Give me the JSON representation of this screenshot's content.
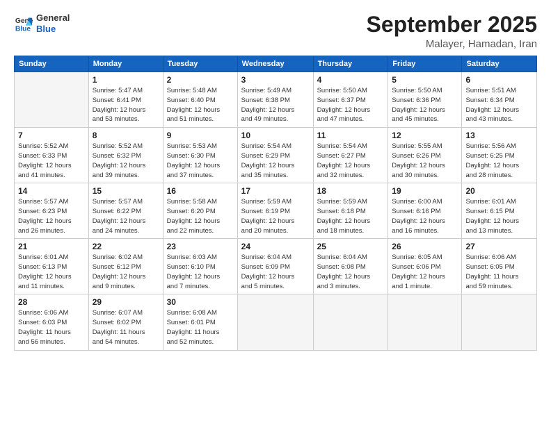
{
  "logo": {
    "line1": "General",
    "line2": "Blue"
  },
  "title": "September 2025",
  "subtitle": "Malayer, Hamadan, Iran",
  "days_header": [
    "Sunday",
    "Monday",
    "Tuesday",
    "Wednesday",
    "Thursday",
    "Friday",
    "Saturday"
  ],
  "weeks": [
    [
      {
        "num": "",
        "info": ""
      },
      {
        "num": "1",
        "info": "Sunrise: 5:47 AM\nSunset: 6:41 PM\nDaylight: 12 hours\nand 53 minutes."
      },
      {
        "num": "2",
        "info": "Sunrise: 5:48 AM\nSunset: 6:40 PM\nDaylight: 12 hours\nand 51 minutes."
      },
      {
        "num": "3",
        "info": "Sunrise: 5:49 AM\nSunset: 6:38 PM\nDaylight: 12 hours\nand 49 minutes."
      },
      {
        "num": "4",
        "info": "Sunrise: 5:50 AM\nSunset: 6:37 PM\nDaylight: 12 hours\nand 47 minutes."
      },
      {
        "num": "5",
        "info": "Sunrise: 5:50 AM\nSunset: 6:36 PM\nDaylight: 12 hours\nand 45 minutes."
      },
      {
        "num": "6",
        "info": "Sunrise: 5:51 AM\nSunset: 6:34 PM\nDaylight: 12 hours\nand 43 minutes."
      }
    ],
    [
      {
        "num": "7",
        "info": "Sunrise: 5:52 AM\nSunset: 6:33 PM\nDaylight: 12 hours\nand 41 minutes."
      },
      {
        "num": "8",
        "info": "Sunrise: 5:52 AM\nSunset: 6:32 PM\nDaylight: 12 hours\nand 39 minutes."
      },
      {
        "num": "9",
        "info": "Sunrise: 5:53 AM\nSunset: 6:30 PM\nDaylight: 12 hours\nand 37 minutes."
      },
      {
        "num": "10",
        "info": "Sunrise: 5:54 AM\nSunset: 6:29 PM\nDaylight: 12 hours\nand 35 minutes."
      },
      {
        "num": "11",
        "info": "Sunrise: 5:54 AM\nSunset: 6:27 PM\nDaylight: 12 hours\nand 32 minutes."
      },
      {
        "num": "12",
        "info": "Sunrise: 5:55 AM\nSunset: 6:26 PM\nDaylight: 12 hours\nand 30 minutes."
      },
      {
        "num": "13",
        "info": "Sunrise: 5:56 AM\nSunset: 6:25 PM\nDaylight: 12 hours\nand 28 minutes."
      }
    ],
    [
      {
        "num": "14",
        "info": "Sunrise: 5:57 AM\nSunset: 6:23 PM\nDaylight: 12 hours\nand 26 minutes."
      },
      {
        "num": "15",
        "info": "Sunrise: 5:57 AM\nSunset: 6:22 PM\nDaylight: 12 hours\nand 24 minutes."
      },
      {
        "num": "16",
        "info": "Sunrise: 5:58 AM\nSunset: 6:20 PM\nDaylight: 12 hours\nand 22 minutes."
      },
      {
        "num": "17",
        "info": "Sunrise: 5:59 AM\nSunset: 6:19 PM\nDaylight: 12 hours\nand 20 minutes."
      },
      {
        "num": "18",
        "info": "Sunrise: 5:59 AM\nSunset: 6:18 PM\nDaylight: 12 hours\nand 18 minutes."
      },
      {
        "num": "19",
        "info": "Sunrise: 6:00 AM\nSunset: 6:16 PM\nDaylight: 12 hours\nand 16 minutes."
      },
      {
        "num": "20",
        "info": "Sunrise: 6:01 AM\nSunset: 6:15 PM\nDaylight: 12 hours\nand 13 minutes."
      }
    ],
    [
      {
        "num": "21",
        "info": "Sunrise: 6:01 AM\nSunset: 6:13 PM\nDaylight: 12 hours\nand 11 minutes."
      },
      {
        "num": "22",
        "info": "Sunrise: 6:02 AM\nSunset: 6:12 PM\nDaylight: 12 hours\nand 9 minutes."
      },
      {
        "num": "23",
        "info": "Sunrise: 6:03 AM\nSunset: 6:10 PM\nDaylight: 12 hours\nand 7 minutes."
      },
      {
        "num": "24",
        "info": "Sunrise: 6:04 AM\nSunset: 6:09 PM\nDaylight: 12 hours\nand 5 minutes."
      },
      {
        "num": "25",
        "info": "Sunrise: 6:04 AM\nSunset: 6:08 PM\nDaylight: 12 hours\nand 3 minutes."
      },
      {
        "num": "26",
        "info": "Sunrise: 6:05 AM\nSunset: 6:06 PM\nDaylight: 12 hours\nand 1 minute."
      },
      {
        "num": "27",
        "info": "Sunrise: 6:06 AM\nSunset: 6:05 PM\nDaylight: 11 hours\nand 59 minutes."
      }
    ],
    [
      {
        "num": "28",
        "info": "Sunrise: 6:06 AM\nSunset: 6:03 PM\nDaylight: 11 hours\nand 56 minutes."
      },
      {
        "num": "29",
        "info": "Sunrise: 6:07 AM\nSunset: 6:02 PM\nDaylight: 11 hours\nand 54 minutes."
      },
      {
        "num": "30",
        "info": "Sunrise: 6:08 AM\nSunset: 6:01 PM\nDaylight: 11 hours\nand 52 minutes."
      },
      {
        "num": "",
        "info": ""
      },
      {
        "num": "",
        "info": ""
      },
      {
        "num": "",
        "info": ""
      },
      {
        "num": "",
        "info": ""
      }
    ]
  ]
}
